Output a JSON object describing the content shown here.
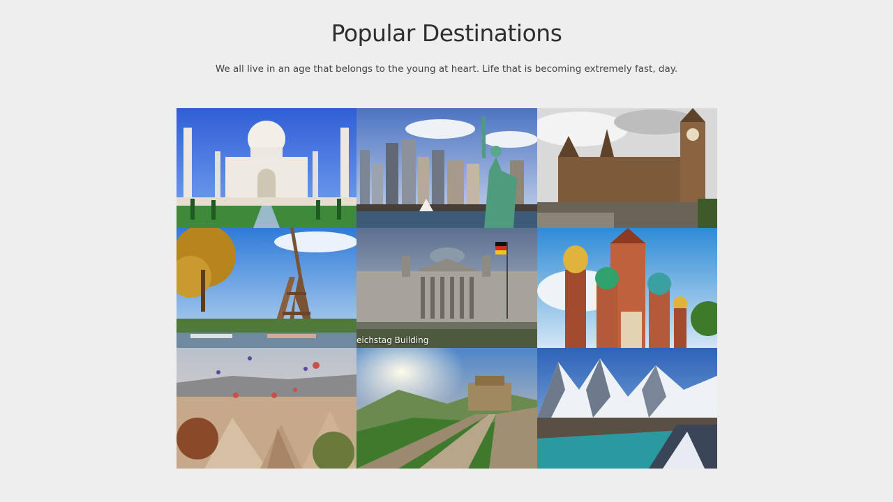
{
  "section": {
    "title": "Popular Destinations",
    "subtitle": "We all live in an age that belongs to the young at heart. Life that is becoming extremely fast, day."
  },
  "destinations": [
    {
      "id": "taj-mahal",
      "caption": ""
    },
    {
      "id": "statue-of-liberty",
      "caption": ""
    },
    {
      "id": "big-ben",
      "caption": ""
    },
    {
      "id": "eiffel-tower",
      "caption": ""
    },
    {
      "id": "reichstag",
      "caption": "eichstag Building"
    },
    {
      "id": "st-basils",
      "caption": ""
    },
    {
      "id": "cappadocia",
      "caption": ""
    },
    {
      "id": "great-wall",
      "caption": ""
    },
    {
      "id": "himalayas",
      "caption": ""
    }
  ]
}
